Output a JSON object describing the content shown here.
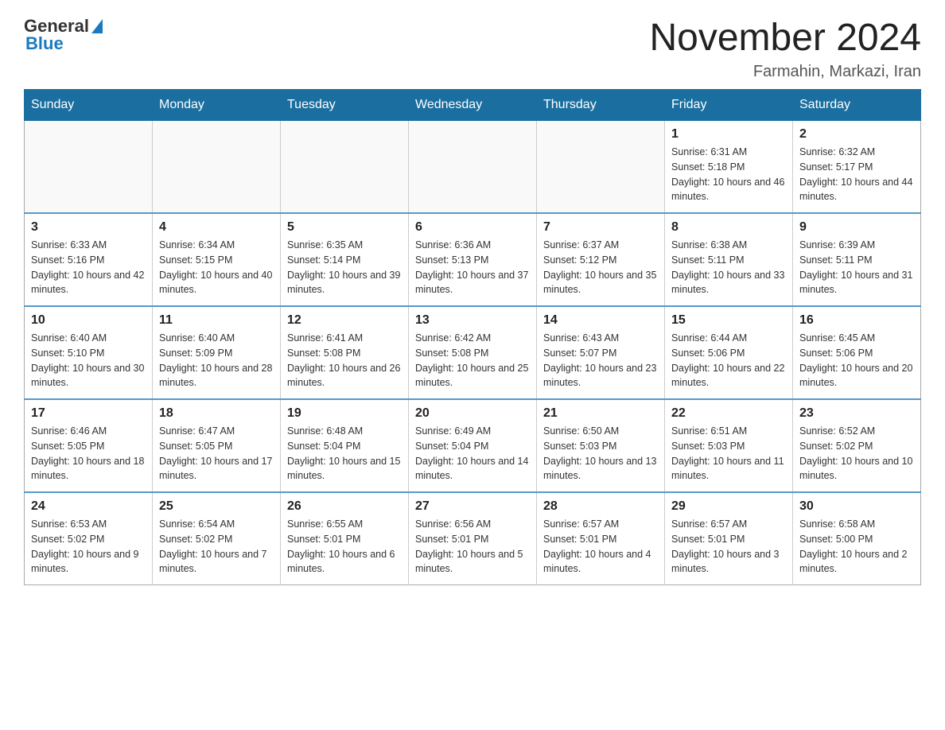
{
  "header": {
    "logo_general": "General",
    "logo_blue": "Blue",
    "month_title": "November 2024",
    "location": "Farmahin, Markazi, Iran"
  },
  "weekdays": [
    "Sunday",
    "Monday",
    "Tuesday",
    "Wednesday",
    "Thursday",
    "Friday",
    "Saturday"
  ],
  "weeks": [
    [
      {
        "day": "",
        "info": ""
      },
      {
        "day": "",
        "info": ""
      },
      {
        "day": "",
        "info": ""
      },
      {
        "day": "",
        "info": ""
      },
      {
        "day": "",
        "info": ""
      },
      {
        "day": "1",
        "info": "Sunrise: 6:31 AM\nSunset: 5:18 PM\nDaylight: 10 hours and 46 minutes."
      },
      {
        "day": "2",
        "info": "Sunrise: 6:32 AM\nSunset: 5:17 PM\nDaylight: 10 hours and 44 minutes."
      }
    ],
    [
      {
        "day": "3",
        "info": "Sunrise: 6:33 AM\nSunset: 5:16 PM\nDaylight: 10 hours and 42 minutes."
      },
      {
        "day": "4",
        "info": "Sunrise: 6:34 AM\nSunset: 5:15 PM\nDaylight: 10 hours and 40 minutes."
      },
      {
        "day": "5",
        "info": "Sunrise: 6:35 AM\nSunset: 5:14 PM\nDaylight: 10 hours and 39 minutes."
      },
      {
        "day": "6",
        "info": "Sunrise: 6:36 AM\nSunset: 5:13 PM\nDaylight: 10 hours and 37 minutes."
      },
      {
        "day": "7",
        "info": "Sunrise: 6:37 AM\nSunset: 5:12 PM\nDaylight: 10 hours and 35 minutes."
      },
      {
        "day": "8",
        "info": "Sunrise: 6:38 AM\nSunset: 5:11 PM\nDaylight: 10 hours and 33 minutes."
      },
      {
        "day": "9",
        "info": "Sunrise: 6:39 AM\nSunset: 5:11 PM\nDaylight: 10 hours and 31 minutes."
      }
    ],
    [
      {
        "day": "10",
        "info": "Sunrise: 6:40 AM\nSunset: 5:10 PM\nDaylight: 10 hours and 30 minutes."
      },
      {
        "day": "11",
        "info": "Sunrise: 6:40 AM\nSunset: 5:09 PM\nDaylight: 10 hours and 28 minutes."
      },
      {
        "day": "12",
        "info": "Sunrise: 6:41 AM\nSunset: 5:08 PM\nDaylight: 10 hours and 26 minutes."
      },
      {
        "day": "13",
        "info": "Sunrise: 6:42 AM\nSunset: 5:08 PM\nDaylight: 10 hours and 25 minutes."
      },
      {
        "day": "14",
        "info": "Sunrise: 6:43 AM\nSunset: 5:07 PM\nDaylight: 10 hours and 23 minutes."
      },
      {
        "day": "15",
        "info": "Sunrise: 6:44 AM\nSunset: 5:06 PM\nDaylight: 10 hours and 22 minutes."
      },
      {
        "day": "16",
        "info": "Sunrise: 6:45 AM\nSunset: 5:06 PM\nDaylight: 10 hours and 20 minutes."
      }
    ],
    [
      {
        "day": "17",
        "info": "Sunrise: 6:46 AM\nSunset: 5:05 PM\nDaylight: 10 hours and 18 minutes."
      },
      {
        "day": "18",
        "info": "Sunrise: 6:47 AM\nSunset: 5:05 PM\nDaylight: 10 hours and 17 minutes."
      },
      {
        "day": "19",
        "info": "Sunrise: 6:48 AM\nSunset: 5:04 PM\nDaylight: 10 hours and 15 minutes."
      },
      {
        "day": "20",
        "info": "Sunrise: 6:49 AM\nSunset: 5:04 PM\nDaylight: 10 hours and 14 minutes."
      },
      {
        "day": "21",
        "info": "Sunrise: 6:50 AM\nSunset: 5:03 PM\nDaylight: 10 hours and 13 minutes."
      },
      {
        "day": "22",
        "info": "Sunrise: 6:51 AM\nSunset: 5:03 PM\nDaylight: 10 hours and 11 minutes."
      },
      {
        "day": "23",
        "info": "Sunrise: 6:52 AM\nSunset: 5:02 PM\nDaylight: 10 hours and 10 minutes."
      }
    ],
    [
      {
        "day": "24",
        "info": "Sunrise: 6:53 AM\nSunset: 5:02 PM\nDaylight: 10 hours and 9 minutes."
      },
      {
        "day": "25",
        "info": "Sunrise: 6:54 AM\nSunset: 5:02 PM\nDaylight: 10 hours and 7 minutes."
      },
      {
        "day": "26",
        "info": "Sunrise: 6:55 AM\nSunset: 5:01 PM\nDaylight: 10 hours and 6 minutes."
      },
      {
        "day": "27",
        "info": "Sunrise: 6:56 AM\nSunset: 5:01 PM\nDaylight: 10 hours and 5 minutes."
      },
      {
        "day": "28",
        "info": "Sunrise: 6:57 AM\nSunset: 5:01 PM\nDaylight: 10 hours and 4 minutes."
      },
      {
        "day": "29",
        "info": "Sunrise: 6:57 AM\nSunset: 5:01 PM\nDaylight: 10 hours and 3 minutes."
      },
      {
        "day": "30",
        "info": "Sunrise: 6:58 AM\nSunset: 5:00 PM\nDaylight: 10 hours and 2 minutes."
      }
    ]
  ]
}
